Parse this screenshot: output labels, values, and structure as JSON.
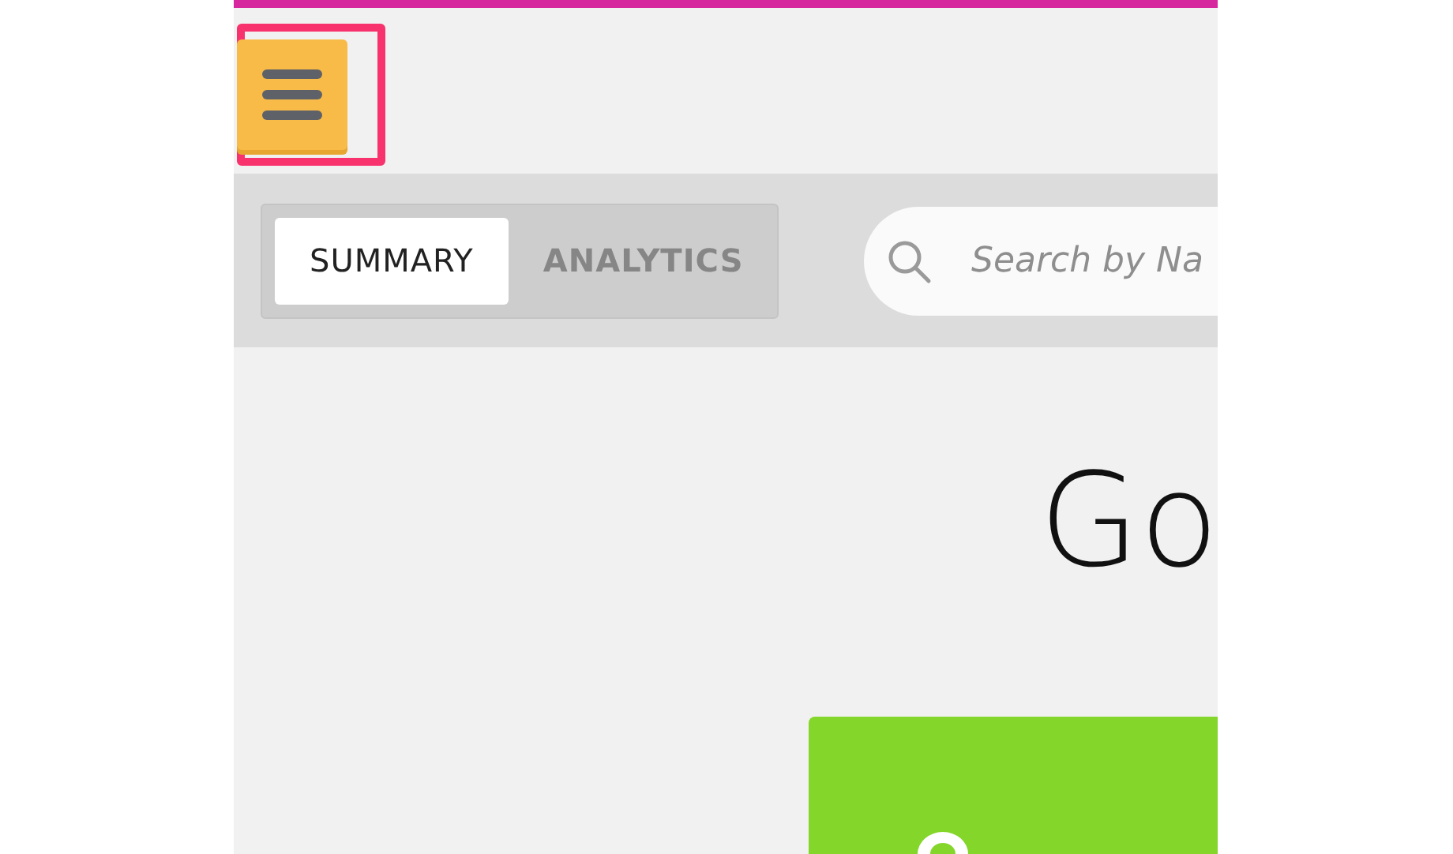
{
  "menu_button": {
    "highlighted": true
  },
  "tabs": [
    {
      "label": "SUMMARY",
      "selected": true
    },
    {
      "label": "ANALYTICS",
      "selected": false
    }
  ],
  "search": {
    "placeholder": "Search by Na"
  },
  "heading": "Go",
  "card": {
    "color": "#84d62a"
  }
}
